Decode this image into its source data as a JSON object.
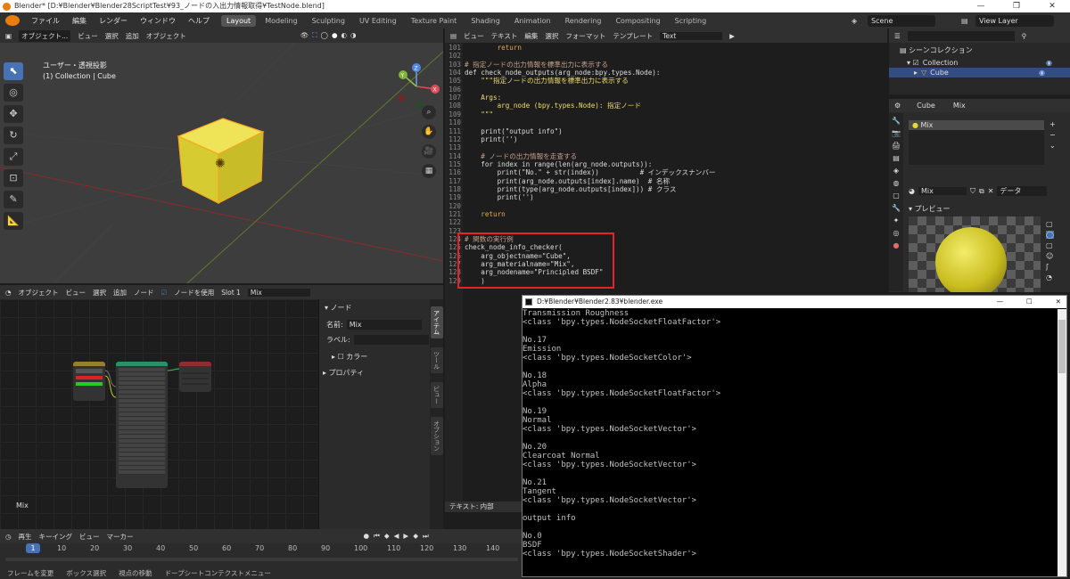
{
  "window": {
    "title": "Blender* [D:¥Blender¥Blender28ScriptTest¥93_ノードの入出力情報取得¥TestNode.blend]"
  },
  "menu": [
    "ファイル",
    "編集",
    "レンダー",
    "ウィンドウ",
    "ヘルプ"
  ],
  "workspaces": [
    "Layout",
    "Modeling",
    "Sculpting",
    "UV Editing",
    "Texture Paint",
    "Shading",
    "Animation",
    "Rendering",
    "Compositing",
    "Scripting"
  ],
  "scene": "Scene",
  "view_layer": "View Layer",
  "viewport": {
    "header": [
      "オブジェクト...",
      "ビュー",
      "選択",
      "追加",
      "オブジェクト"
    ],
    "orient": "グロー...",
    "options": "オプション",
    "view_name": "ユーザー・透視投影",
    "collection_info": "(1) Collection | Cube"
  },
  "text_editor": {
    "header": [
      "ビュー",
      "テキスト",
      "編集",
      "選択",
      "フォーマット",
      "テンプレート"
    ],
    "file": "Text",
    "footer": "テキスト: 内部",
    "lines": [
      {
        "n": "101",
        "t": "        return",
        "c": "#e9a54f"
      },
      {
        "n": "102",
        "t": "",
        "c": "#ddd"
      },
      {
        "n": "103",
        "t": "# 指定ノードの出力情報を標準出力に表示する",
        "c": "#c9a08a"
      },
      {
        "n": "104",
        "t": "def check_node_outputs(arg_node:bpy.types.Node):",
        "c": "#ddd"
      },
      {
        "n": "105",
        "t": "    \"\"\"指定ノードの出力情報を標準出力に表示する",
        "c": "#f0dc6e"
      },
      {
        "n": "106",
        "t": "",
        "c": "#ddd"
      },
      {
        "n": "107",
        "t": "    Args:",
        "c": "#f0dc6e"
      },
      {
        "n": "108",
        "t": "        arg_node (bpy.types.Node): 指定ノード",
        "c": "#f0dc6e"
      },
      {
        "n": "109",
        "t": "    \"\"\"",
        "c": "#f0dc6e"
      },
      {
        "n": "110",
        "t": "",
        "c": "#ddd"
      },
      {
        "n": "111",
        "t": "    print(\"output info\")",
        "c": "#ddd"
      },
      {
        "n": "112",
        "t": "    print('')",
        "c": "#ddd"
      },
      {
        "n": "113",
        "t": "",
        "c": "#ddd"
      },
      {
        "n": "114",
        "t": "    # ノードの出力情報を走査する",
        "c": "#c9a08a"
      },
      {
        "n": "115",
        "t": "    for index in range(len(arg_node.outputs)):",
        "c": "#ddd"
      },
      {
        "n": "116",
        "t": "        print(\"No.\" + str(index))          # インデックスナンバー",
        "c": "#ddd"
      },
      {
        "n": "117",
        "t": "        print(arg_node.outputs[index].name)  # 名称",
        "c": "#ddd"
      },
      {
        "n": "118",
        "t": "        print(type(arg_node.outputs[index])) # クラス",
        "c": "#ddd"
      },
      {
        "n": "119",
        "t": "        print('')",
        "c": "#ddd"
      },
      {
        "n": "120",
        "t": "",
        "c": "#ddd"
      },
      {
        "n": "121",
        "t": "    return",
        "c": "#e9a54f"
      },
      {
        "n": "122",
        "t": "",
        "c": "#ddd"
      },
      {
        "n": "123",
        "t": "",
        "c": "#ddd"
      },
      {
        "n": "124",
        "t": "# 関数の実行例",
        "c": "#c9a08a"
      },
      {
        "n": "125",
        "t": "check_node_info_checker(",
        "c": "#ddd"
      },
      {
        "n": "126",
        "t": "    arg_objectname=\"Cube\",",
        "c": "#ddd"
      },
      {
        "n": "127",
        "t": "    arg_materialname=\"Mix\",",
        "c": "#ddd"
      },
      {
        "n": "128",
        "t": "    arg_nodename=\"Principled BSDF\"",
        "c": "#ddd"
      },
      {
        "n": "129",
        "t": "    )",
        "c": "#ddd"
      }
    ]
  },
  "outliner": {
    "header": "シーンコレクション",
    "collection": "Collection",
    "object": "Cube"
  },
  "properties": {
    "object": "Cube",
    "material": "Mix",
    "slot_item": "Mix",
    "mat_field": "Mix",
    "data_label": "データ",
    "preview_label": "プレビュー"
  },
  "node_editor": {
    "header": [
      "オブジェクト",
      "ビュー",
      "選択",
      "追加",
      "ノード"
    ],
    "use_nodes": "ノードを使用",
    "slot": "Slot 1",
    "material": "Mix",
    "label_mix": "Mix",
    "panel": {
      "section": "ノード",
      "name_label": "名前:",
      "name_value": "Mix",
      "label_label": "ラベル:",
      "color_label": "カラー",
      "props_label": "プロパティ"
    },
    "side_tabs": [
      "アイテム",
      "ツール",
      "ビュー",
      "オプション"
    ]
  },
  "timeline": {
    "menu": [
      "再生",
      "キーイング",
      "ビュー",
      "マーカー"
    ],
    "frame": "1",
    "ticks": [
      "10",
      "20",
      "30",
      "40",
      "50",
      "60",
      "70",
      "80",
      "90",
      "100",
      "110",
      "120",
      "130",
      "140"
    ]
  },
  "status": [
    "フレームを変更",
    "ボックス選択",
    "視点の移動",
    "ドープシートコンテクストメニュー"
  ],
  "console": {
    "title": "D:¥Blender¥Blender2.83¥blender.exe",
    "lines": [
      "Transmission Roughness",
      "<class 'bpy.types.NodeSocketFloatFactor'>",
      "",
      "No.17",
      "Emission",
      "<class 'bpy.types.NodeSocketColor'>",
      "",
      "No.18",
      "Alpha",
      "<class 'bpy.types.NodeSocketFloatFactor'>",
      "",
      "No.19",
      "Normal",
      "<class 'bpy.types.NodeSocketVector'>",
      "",
      "No.20",
      "Clearcoat Normal",
      "<class 'bpy.types.NodeSocketVector'>",
      "",
      "No.21",
      "Tangent",
      "<class 'bpy.types.NodeSocketVector'>",
      "",
      "output info",
      "",
      "No.0",
      "BSDF",
      "<class 'bpy.types.NodeSocketShader'>"
    ]
  },
  "colors": {
    "highlight_box": "#e8222a",
    "accent": "#4772b3",
    "cube": "#e5d83a"
  }
}
